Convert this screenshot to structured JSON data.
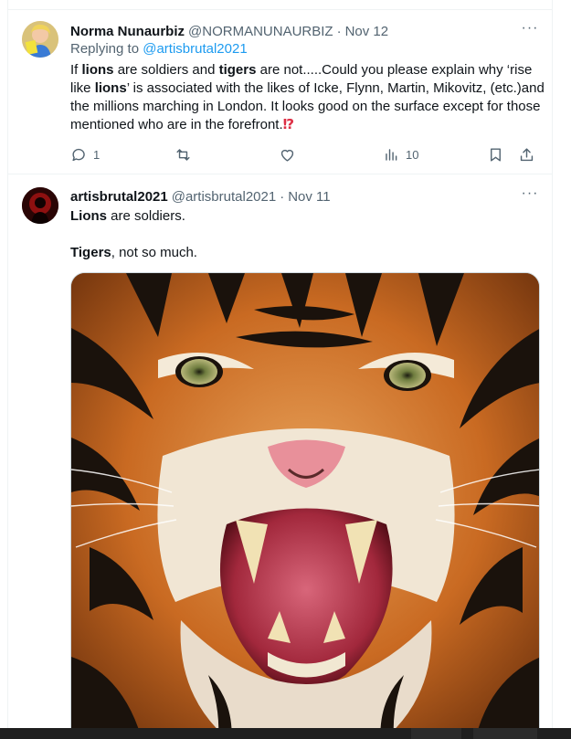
{
  "reply_tweet": {
    "name": "Norma Nunaurbiz",
    "handle": "@NORMANUNAURBIZ",
    "separator": "·",
    "date": "Nov 12",
    "more_label": "···",
    "replying_prefix": "Replying to",
    "replying_to": "@artisbrutal2021",
    "text": {
      "t1": "If ",
      "b1": "lions",
      "t2": " are soldiers and ",
      "b2": "tigers",
      "t3": " are not.....Could you please explain why ‘rise like ",
      "b3": "lions",
      "t4": "’ is associated with the likes of Icke, Flynn, Martin, Mikovitz, (etc.)and the millions marching in London. It looks good on the surface except for those mentioned who are in the forefront.",
      "emoji": "⁉"
    },
    "actions": {
      "reply_count": "1",
      "retweet_count": "",
      "like_count": "",
      "views_count": "10"
    }
  },
  "original_tweet": {
    "name": "artisbrutal2021",
    "handle": "@artisbrutal2021",
    "separator": "·",
    "date": "Nov 11",
    "more_label": "···",
    "line1_bold": "Lions",
    "line1_rest": " are soldiers.",
    "line2_bold": "Tigers",
    "line2_rest": ", not so much.",
    "media_subject": "snarling tiger face"
  },
  "colors": {
    "link": "#1d9bf0",
    "secondary_text": "#536471",
    "primary_text": "#0f1419",
    "border": "#eff3f4"
  }
}
